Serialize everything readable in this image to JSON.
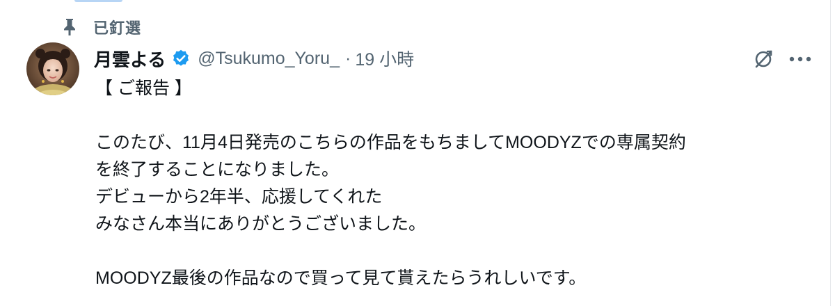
{
  "pinned_label": "已釘選",
  "user": {
    "display_name": "月雲よる",
    "handle": "@Tsukumo_Yoru_",
    "separator": "·",
    "time": "19 小時"
  },
  "tweet": {
    "lines": [
      "【 ご報告 】",
      "",
      "このたび、11月4日発売のこちらの作品をもちましてMOODYZでの専属契約",
      "を終了することになりました。",
      "デビューから2年半、応援してくれた",
      "みなさん本当にありがとうございました。",
      "",
      "MOODYZ最後の作品なので買って見て貰えたらうれしいです。"
    ]
  },
  "icons": {
    "pin": "pin-icon",
    "verified": "verified-badge-icon",
    "grok": "grok-icon",
    "more": "more-options-icon"
  },
  "colors": {
    "verified_blue": "#1d9bf0",
    "secondary_text": "#536471",
    "primary_text": "#0f1419"
  }
}
